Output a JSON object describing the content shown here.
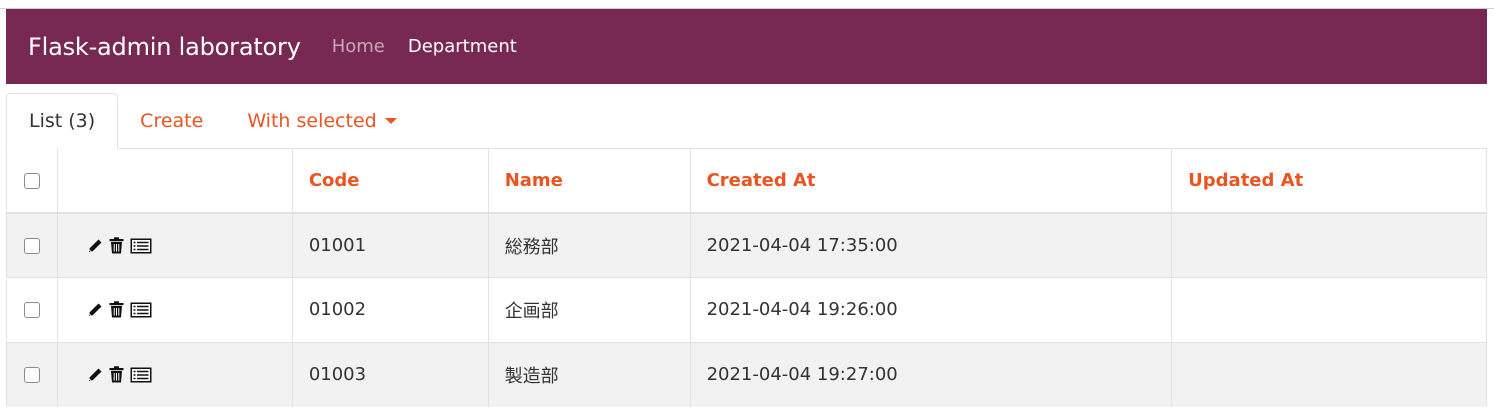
{
  "navbar": {
    "brand": "Flask-admin laboratory",
    "links": [
      {
        "label": "Home",
        "active": false
      },
      {
        "label": "Department",
        "active": true
      }
    ]
  },
  "tabs": {
    "list": "List (3)",
    "create": "Create",
    "with_selected": "With selected"
  },
  "table": {
    "columns": [
      "Code",
      "Name",
      "Created At",
      "Updated At"
    ],
    "rows": [
      {
        "code": "01001",
        "name": "総務部",
        "created_at": "2021-04-04 17:35:00",
        "updated_at": ""
      },
      {
        "code": "01002",
        "name": "企画部",
        "created_at": "2021-04-04 19:26:00",
        "updated_at": ""
      },
      {
        "code": "01003",
        "name": "製造部",
        "created_at": "2021-04-04 19:27:00",
        "updated_at": ""
      }
    ],
    "row_actions": [
      "pencil-icon",
      "trash-icon",
      "details-icon"
    ]
  },
  "colors": {
    "navbar": "#772953",
    "accent": "#e95420",
    "stripe": "#f2f2f2"
  }
}
